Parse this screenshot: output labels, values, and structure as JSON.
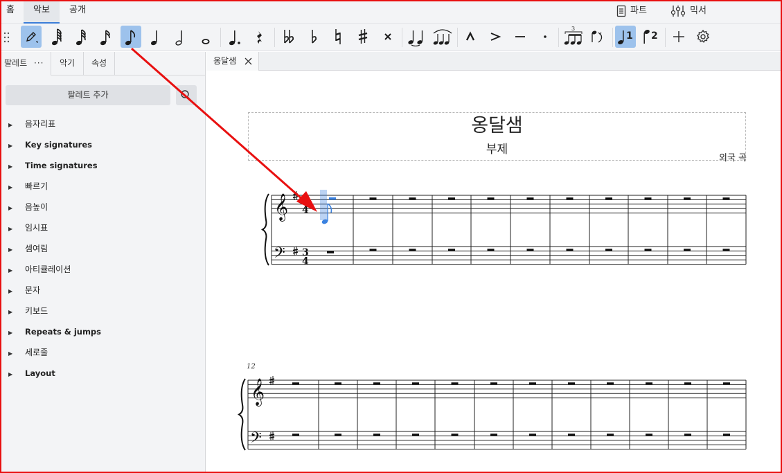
{
  "menu": {
    "tabs": [
      {
        "label": "홈",
        "active": false
      },
      {
        "label": "악보",
        "active": true
      },
      {
        "label": "공개",
        "active": false
      }
    ],
    "parts_label": "파트",
    "mixer_label": "믹서"
  },
  "toolbar": {
    "accent_color": "#9dc2ec",
    "buttons": [
      {
        "name": "note-input-pencil-icon",
        "on": true
      },
      {
        "name": "64th-note-icon",
        "on": false
      },
      {
        "name": "32nd-note-icon",
        "on": false
      },
      {
        "name": "16th-note-icon",
        "on": false
      },
      {
        "name": "eighth-note-icon",
        "on": true
      },
      {
        "name": "quarter-note-icon",
        "on": false
      },
      {
        "name": "half-note-icon",
        "on": false
      },
      {
        "name": "whole-note-icon",
        "on": false
      },
      {
        "name": "augmentation-dot-icon",
        "on": false
      },
      {
        "name": "rest-icon",
        "on": false
      },
      {
        "name": "double-flat-icon",
        "on": false
      },
      {
        "name": "flat-icon",
        "on": false
      },
      {
        "name": "natural-icon",
        "on": false
      },
      {
        "name": "sharp-icon",
        "on": false
      },
      {
        "name": "double-sharp-icon",
        "on": false
      },
      {
        "name": "tie-icon",
        "on": false
      },
      {
        "name": "slur-icon",
        "on": false
      },
      {
        "name": "marcato-icon",
        "on": false
      },
      {
        "name": "accent-icon",
        "on": false
      },
      {
        "name": "tenuto-icon",
        "on": false
      },
      {
        "name": "staccato-icon",
        "on": false
      },
      {
        "name": "tuplet-icon",
        "on": false
      },
      {
        "name": "flip-direction-icon",
        "on": false
      },
      {
        "name": "voice-1-icon",
        "on": true
      },
      {
        "name": "voice-2-icon",
        "on": false
      },
      {
        "name": "add-icon",
        "on": false
      },
      {
        "name": "gear-icon",
        "on": false
      }
    ],
    "tuplet_number": "3",
    "voice1_number": "1",
    "voice2_number": "2"
  },
  "panel": {
    "tabs": [
      {
        "label": "팔레트",
        "active": true
      },
      {
        "label": "악기",
        "active": false
      },
      {
        "label": "속성",
        "active": false
      }
    ],
    "more_label": "···",
    "add_palette_label": "팔레트 추가",
    "items": [
      {
        "label": "음자리표",
        "bold": false
      },
      {
        "label": "Key signatures",
        "bold": true
      },
      {
        "label": "Time signatures",
        "bold": true
      },
      {
        "label": "빠르기",
        "bold": false
      },
      {
        "label": "음높이",
        "bold": false
      },
      {
        "label": "임시표",
        "bold": false
      },
      {
        "label": "셈여림",
        "bold": false
      },
      {
        "label": "아티큘레이션",
        "bold": false
      },
      {
        "label": "문자",
        "bold": false
      },
      {
        "label": "키보드",
        "bold": false
      },
      {
        "label": "Repeats & jumps",
        "bold": true
      },
      {
        "label": "세로줄",
        "bold": false
      },
      {
        "label": "Layout",
        "bold": true
      }
    ]
  },
  "document": {
    "tab_label": "옹달샘",
    "title": "옹달샘",
    "subtitle": "부제",
    "composer": "외국 곡",
    "second_system_measure": "12",
    "time_signature": {
      "numerator": "3",
      "denominator": "4"
    },
    "selection_color": "#3b82e0",
    "annotation_color": "#e81010"
  }
}
